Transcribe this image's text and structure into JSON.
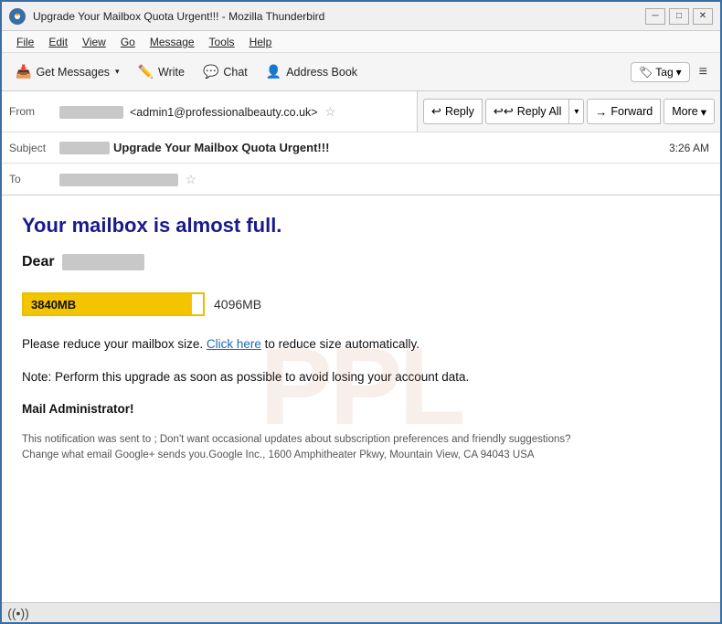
{
  "window": {
    "title": "Upgrade Your Mailbox Quota Urgent!!! - Mozilla Thunderbird",
    "icon": "thunderbird"
  },
  "titlebar": {
    "title": "Upgrade Your Mailbox Quota Urgent!!! - Mozilla Thunderbird",
    "minimize_label": "─",
    "maximize_label": "□",
    "close_label": "✕"
  },
  "menubar": {
    "items": [
      {
        "label": "File",
        "underline_char": "F"
      },
      {
        "label": "Edit",
        "underline_char": "E"
      },
      {
        "label": "View",
        "underline_char": "V"
      },
      {
        "label": "Go",
        "underline_char": "G"
      },
      {
        "label": "Message",
        "underline_char": "M"
      },
      {
        "label": "Tools",
        "underline_char": "T"
      },
      {
        "label": "Help",
        "underline_char": "H"
      }
    ]
  },
  "toolbar": {
    "get_messages_label": "Get Messages",
    "write_label": "Write",
    "chat_label": "Chat",
    "address_book_label": "Address Book",
    "tag_label": "Tag",
    "hamburger_icon": "≡"
  },
  "email_header": {
    "from_label": "From",
    "from_name_redacted": true,
    "from_email": "<admin1@professionalbeauty.co.uk>",
    "subject_label": "Subject",
    "subject_text": "Upgrade Your Mailbox Quota Urgent!!!",
    "subject_time": "3:26 AM",
    "to_label": "To",
    "reply_label": "Reply",
    "reply_all_label": "Reply All",
    "forward_label": "Forward",
    "more_label": "More",
    "reply_icon": "↩",
    "reply_all_icon": "↩↩",
    "forward_icon": "→",
    "dropdown_icon": "▾"
  },
  "email_body": {
    "headline": "Your mailbox is almost full.",
    "dear_prefix": "Dear",
    "dear_name_redacted": true,
    "quota_used": "3840MB",
    "quota_total": "4096MB",
    "quota_percent": 93.75,
    "paragraph1_before_link": "Please reduce your mailbox size. ",
    "paragraph1_link": "Click here",
    "paragraph1_after_link": " to reduce size automatically.",
    "paragraph2": "Note: Perform this upgrade as soon as possible to avoid  losing your account data.",
    "footer_bold": "Mail Administrator!",
    "footer_text": "This notification was sent to ; Don't want occasional updates about subscription preferences and friendly suggestions?\nChange what email Google+ sends you.Google Inc., 1600 Amphitheater Pkwy, Mountain View, CA 94043 USA"
  },
  "status_bar": {
    "wifi_icon": "((•))"
  }
}
